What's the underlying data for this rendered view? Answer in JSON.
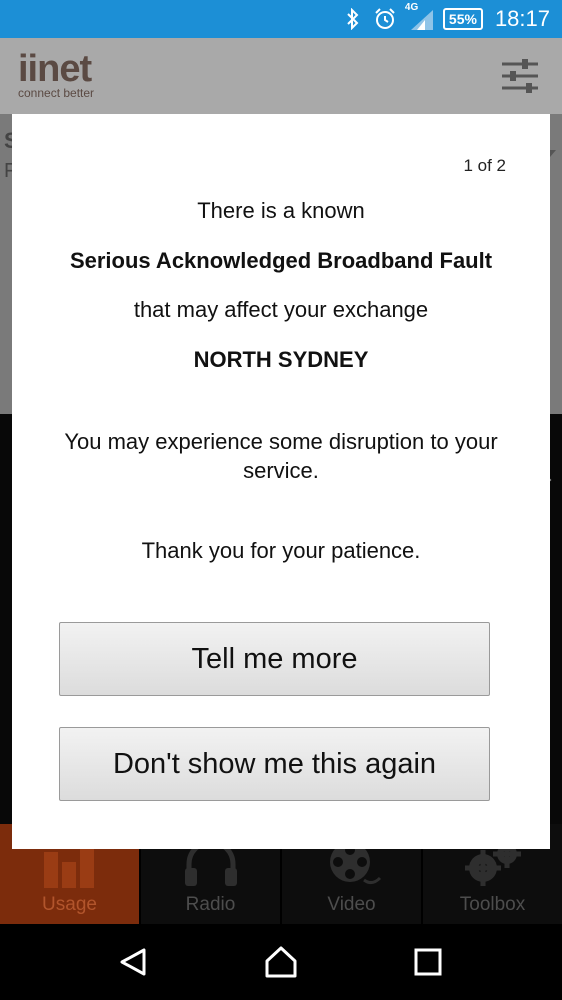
{
  "status_bar": {
    "network_label": "4G",
    "battery": "55%",
    "time": "18:17",
    "icons": [
      "bluetooth-icon",
      "alarm-icon",
      "signal-icon"
    ],
    "color": "#1c8fd6"
  },
  "app_bar": {
    "logo_word": "iinet",
    "logo_tagline": "connect better",
    "settings_icon": "sliders-icon"
  },
  "background": {
    "edge_letter_1": "S",
    "edge_letter_2": "F"
  },
  "dialog": {
    "pager": "1 of 2",
    "line1": "There is a known",
    "line2": "Serious Acknowledged Broadband Fault",
    "line3": "that may affect your exchange",
    "exchange": "NORTH SYDNEY",
    "disruption": "You may experience some disruption to your service.",
    "thanks": "Thank you for your patience.",
    "btn_more": "Tell me more",
    "btn_dismiss": "Don't show me this again"
  },
  "tabs": [
    {
      "label": "Usage",
      "icon": "bar-chart-icon",
      "active": true
    },
    {
      "label": "Radio",
      "icon": "headphones-icon",
      "active": false
    },
    {
      "label": "Video",
      "icon": "film-reel-icon",
      "active": false
    },
    {
      "label": "Toolbox",
      "icon": "gears-icon",
      "active": false
    }
  ],
  "nav": [
    "back-icon",
    "home-icon",
    "recents-icon"
  ]
}
